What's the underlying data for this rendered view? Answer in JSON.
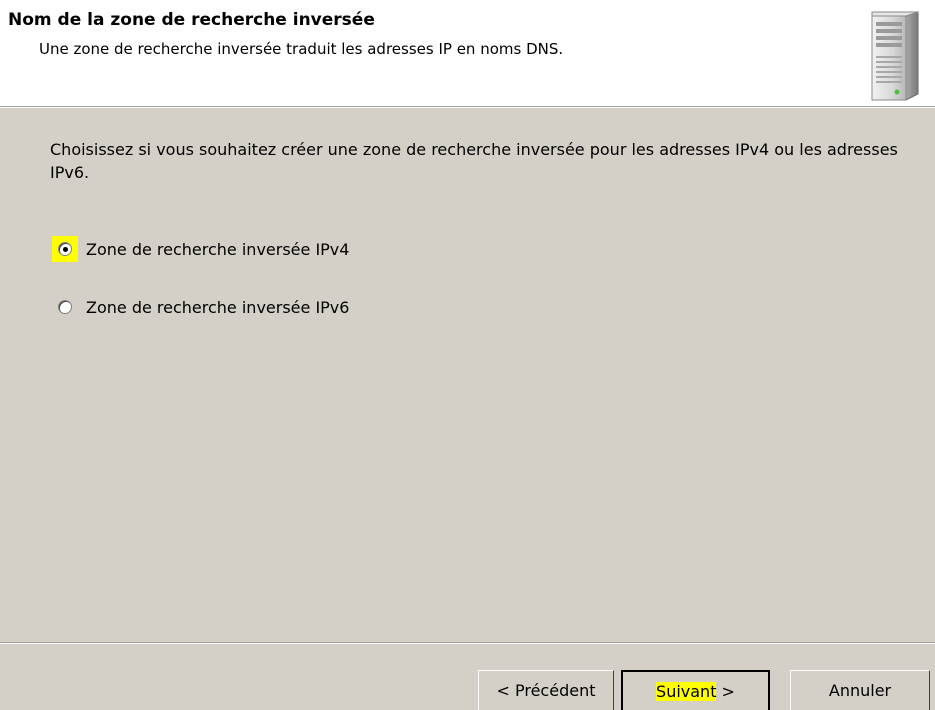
{
  "header": {
    "title": "Nom de la zone de recherche inversée",
    "subtitle": "Une zone de recherche inversée traduit les adresses IP en noms DNS.",
    "icon": "server-icon"
  },
  "body": {
    "intro": "Choisissez si vous souhaitez créer une zone de recherche inversée pour les adresses IPv4 ou les adresses IPv6.",
    "options": [
      {
        "label": "Zone de recherche inversée IPv4",
        "selected": true
      },
      {
        "label": "Zone de recherche inversée IPv6",
        "selected": false
      }
    ]
  },
  "footer": {
    "back_label": "< Précédent",
    "next_label_highlight": "Suivant",
    "next_label_rest": " >",
    "cancel_label": "Annuler"
  },
  "colors": {
    "dialog_bg": "#d4d0c8",
    "header_bg": "#ffffff",
    "highlight": "#ffff00"
  }
}
